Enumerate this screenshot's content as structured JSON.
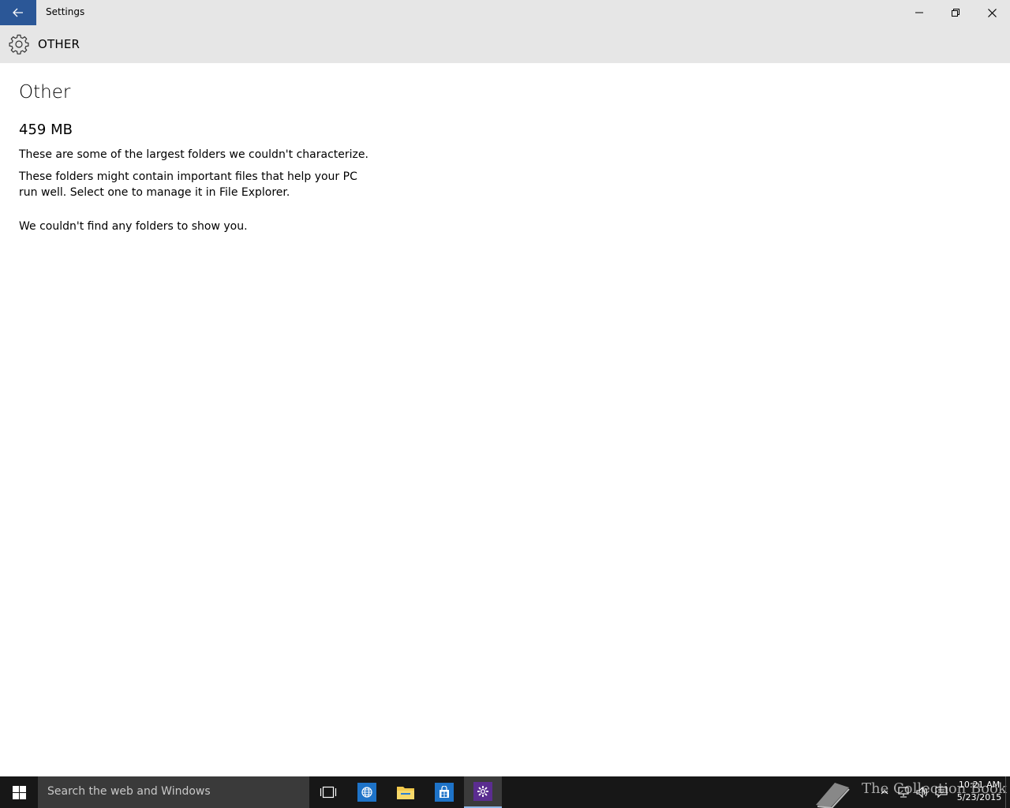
{
  "window": {
    "title": "Settings",
    "accent": "#2b5797"
  },
  "header": {
    "title": "OTHER"
  },
  "main": {
    "title": "Other",
    "size": "459 MB",
    "paragraphs": [
      "These are some of the largest folders we couldn't characterize.",
      "These folders might contain important files that help your PC run well. Select one to manage it in File Explorer.",
      "We couldn't find any folders to show you."
    ]
  },
  "taskbar": {
    "search_placeholder": "Search the web and Windows",
    "watermark": "The Collection Book",
    "clock": {
      "time": "10:21 AM",
      "date": "5/23/2015"
    },
    "icons": [
      "windows-start-icon",
      "task-view-icon",
      "internet-explorer-icon",
      "file-explorer-icon",
      "store-icon",
      "settings-icon"
    ]
  }
}
